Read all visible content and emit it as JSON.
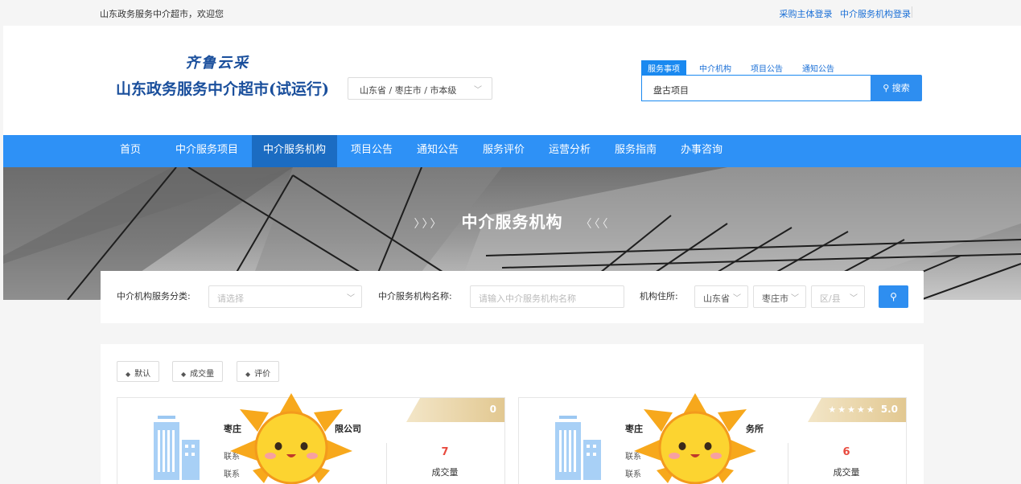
{
  "topbar": {
    "welcome": "山东政务服务中介超市，欢迎您",
    "login_buyer": "采购主体登录",
    "login_agency": "中介服务机构登录"
  },
  "header": {
    "logo_top": "齐鲁云采",
    "logo_main": "山东政务服务中介超市(试运行)",
    "region": "山东省 / 枣庄市 / 市本级",
    "search_tabs": [
      "服务事项",
      "中介机构",
      "项目公告",
      "通知公告"
    ],
    "search_value": "盘古项目",
    "search_button": "搜索"
  },
  "nav": {
    "items": [
      "首页",
      "中介服务项目",
      "中介服务机构",
      "项目公告",
      "通知公告",
      "服务评价",
      "运营分析",
      "服务指南",
      "办事咨询"
    ],
    "active": "中介服务机构"
  },
  "banner": {
    "left_arrows": "〉〉〉",
    "title": "中介服务机构",
    "right_arrows": "〈〈〈"
  },
  "filter": {
    "category_label": "中介机构服务分类:",
    "category_placeholder": "请选择",
    "name_label": "中介服务机构名称:",
    "name_placeholder": "请输入中介服务机构名称",
    "address_label": "机构住所:",
    "province": "山东省",
    "city": "枣庄市",
    "district_placeholder": "区/县"
  },
  "sort": {
    "default": "默认",
    "volume": "成交量",
    "rating": "评价"
  },
  "cards": [
    {
      "name_start": "枣庄",
      "name_end": "限公司",
      "line1": "联系",
      "line2": "联系",
      "ribbon": "0",
      "count": "7",
      "count_label": "成交量"
    },
    {
      "name_start": "枣庄",
      "name_end": "务所",
      "line1": "联系",
      "line2": "联系",
      "stars": "★★★★★",
      "ribbon": "5.0",
      "count": "6",
      "count_label": "成交量"
    }
  ],
  "colors": {
    "nav": "#2e91f6",
    "nav_active": "#1b6cc2",
    "accent": "#2e8ef0",
    "count": "#e84a3e",
    "ribbon": "#e2c891"
  },
  "icons": [
    "search-icon",
    "chevron-down-icon",
    "sort-icon",
    "building-icon",
    "sun-sticker-icon",
    "star-icon"
  ]
}
